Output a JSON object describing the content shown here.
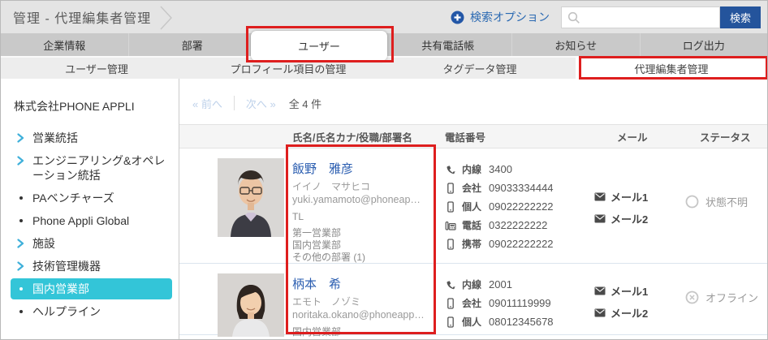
{
  "colors": {
    "accent": "#2a69b2",
    "button": "#24549c",
    "link": "#2a5db0",
    "cyan": "#33c5d8",
    "chevron": "#3fb0da",
    "red": "#de1e1e"
  },
  "header": {
    "title": "管理 - 代理編集者管理",
    "search_options": "検索オプション",
    "search_value": "",
    "search_button": "検索"
  },
  "tabs": {
    "items": [
      "企業情報",
      "部署",
      "ユーザー",
      "共有電話帳",
      "お知らせ",
      "ログ出力"
    ],
    "active": "ユーザー"
  },
  "subtabs": {
    "items": [
      "ユーザー管理",
      "プロフィール項目の管理",
      "タグデータ管理",
      "代理編集者管理"
    ],
    "active": "代理編集者管理"
  },
  "sidebar": {
    "company": "株式会社PHONE APPLI",
    "items": [
      {
        "label": "営業統括",
        "type": "chevron",
        "selected": false
      },
      {
        "label": "エンジニアリング&オペレーション統括",
        "type": "chevron",
        "selected": false
      },
      {
        "label": "PAベンチャーズ",
        "type": "bullet",
        "selected": false
      },
      {
        "label": "Phone Appli Global",
        "type": "bullet",
        "selected": false
      },
      {
        "label": "施設",
        "type": "chevron",
        "selected": false
      },
      {
        "label": "技術管理機器",
        "type": "chevron",
        "selected": false
      },
      {
        "label": "国内営業部",
        "type": "bullet",
        "selected": true
      },
      {
        "label": "ヘルプライン",
        "type": "bullet",
        "selected": false
      }
    ]
  },
  "pagination": {
    "prev": "« 前へ",
    "next": "次へ »",
    "total": "全 4 件"
  },
  "table": {
    "headers": [
      "氏名/氏名カナ/役職/部署名",
      "電話番号",
      "メール",
      "ステータス"
    ]
  },
  "rows": [
    {
      "name": "飯野　雅彦",
      "kana": "イイノ　マサヒコ",
      "email": "yuki.yamamoto@phoneap…",
      "title": "TL",
      "departments": [
        "第一営業部",
        "国内営業部",
        "その他の部署 (1)"
      ],
      "phones": [
        {
          "icon": "handset-icon",
          "label": "内線",
          "number": "3400"
        },
        {
          "icon": "mobile-icon",
          "label": "会社",
          "number": "09033334444"
        },
        {
          "icon": "mobile-icon",
          "label": "個人",
          "number": "09022222222"
        },
        {
          "icon": "deskphone-icon",
          "label": "電話",
          "number": "0322222222"
        },
        {
          "icon": "mobile-icon",
          "label": "携帯",
          "number": "09022222222"
        }
      ],
      "mails": [
        "メール1",
        "メール2"
      ],
      "status": {
        "label": "状態不明",
        "icon": "unknown-circle"
      }
    },
    {
      "name": "柄本　希",
      "kana": "エモト　ノゾミ",
      "email": "noritaka.okano@phoneapp…",
      "departments": [
        "国内営業部"
      ],
      "phones": [
        {
          "icon": "handset-icon",
          "label": "内線",
          "number": "2001"
        },
        {
          "icon": "mobile-icon",
          "label": "会社",
          "number": "09011119999"
        },
        {
          "icon": "mobile-icon",
          "label": "個人",
          "number": "08012345678"
        }
      ],
      "mails": [
        "メール1",
        "メール2"
      ],
      "status": {
        "label": "オフライン",
        "icon": "offline-circle-x"
      }
    }
  ]
}
